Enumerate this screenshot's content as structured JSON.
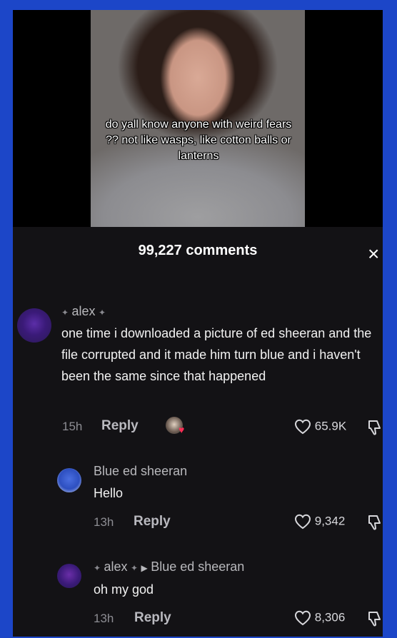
{
  "video": {
    "caption": "do yall know anyone with weird fears ?? not like wasps, like cotton balls or lanterns"
  },
  "header": {
    "comments_count": "99,227 comments",
    "close_label": "×"
  },
  "comments": [
    {
      "username": "alex",
      "text": "one time i downloaded a picture of ed sheeran and the file corrupted and it made him turn blue and i haven't been the same since that happened",
      "time": "15h",
      "reply_label": "Reply",
      "likes": "65.9K"
    },
    {
      "username": "Blue ed sheeran",
      "text": "Hello",
      "time": "13h",
      "reply_label": "Reply",
      "likes": "9,342"
    },
    {
      "username": "alex",
      "reply_to": "Blue ed sheeran",
      "text": "oh my god",
      "time": "13h",
      "reply_label": "Reply",
      "likes": "8,306"
    }
  ],
  "colors": {
    "frame_border": "#1c46c8",
    "background": "#131215",
    "creator_heart": "#ff2d55"
  },
  "icons": [
    "close-icon",
    "heart-outline-icon",
    "dislike-icon",
    "avatar",
    "creator-liked-icon"
  ]
}
